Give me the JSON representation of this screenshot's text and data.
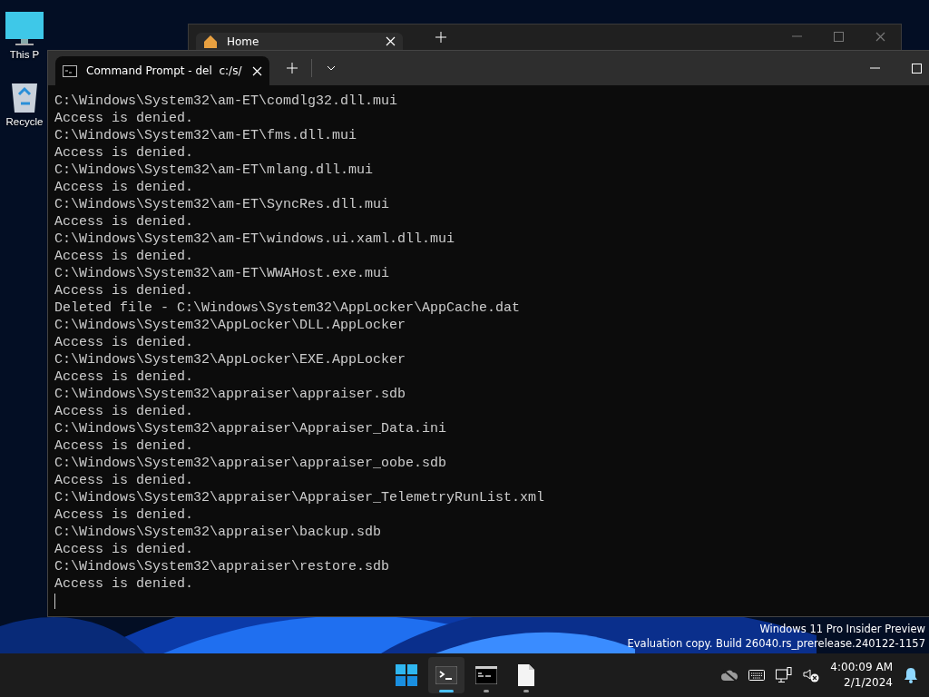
{
  "desktop_icons": [
    {
      "kind": "monitor",
      "label": "This P"
    },
    {
      "kind": "recycle",
      "label": "Recycle"
    }
  ],
  "back_window": {
    "tab_title": "Home"
  },
  "terminal": {
    "tab_title": "Command Prompt - del  c:/s/",
    "lines": [
      "C:\\Windows\\System32\\am-ET\\comdlg32.dll.mui",
      "Access is denied.",
      "C:\\Windows\\System32\\am-ET\\fms.dll.mui",
      "Access is denied.",
      "C:\\Windows\\System32\\am-ET\\mlang.dll.mui",
      "Access is denied.",
      "C:\\Windows\\System32\\am-ET\\SyncRes.dll.mui",
      "Access is denied.",
      "C:\\Windows\\System32\\am-ET\\windows.ui.xaml.dll.mui",
      "Access is denied.",
      "C:\\Windows\\System32\\am-ET\\WWAHost.exe.mui",
      "Access is denied.",
      "Deleted file - C:\\Windows\\System32\\AppLocker\\AppCache.dat",
      "C:\\Windows\\System32\\AppLocker\\DLL.AppLocker",
      "Access is denied.",
      "C:\\Windows\\System32\\AppLocker\\EXE.AppLocker",
      "Access is denied.",
      "C:\\Windows\\System32\\appraiser\\appraiser.sdb",
      "Access is denied.",
      "C:\\Windows\\System32\\appraiser\\Appraiser_Data.ini",
      "Access is denied.",
      "C:\\Windows\\System32\\appraiser\\appraiser_oobe.sdb",
      "Access is denied.",
      "C:\\Windows\\System32\\appraiser\\Appraiser_TelemetryRunList.xml",
      "Access is denied.",
      "C:\\Windows\\System32\\appraiser\\backup.sdb",
      "Access is denied.",
      "C:\\Windows\\System32\\appraiser\\restore.sdb",
      "Access is denied."
    ]
  },
  "watermark": [
    "Windows 11 Pro Insider Preview",
    "Evaluation copy. Build 26040.rs_prerelease.240122-1157"
  ],
  "taskbar": {
    "apps": [
      {
        "kind": "start",
        "selected": false,
        "running": false
      },
      {
        "kind": "terminal",
        "selected": true,
        "running": true
      },
      {
        "kind": "cmd",
        "selected": false,
        "running": true
      },
      {
        "kind": "file",
        "selected": false,
        "running": true
      }
    ],
    "tray": [
      {
        "kind": "cloud-off"
      },
      {
        "kind": "keyboard"
      },
      {
        "kind": "network"
      },
      {
        "kind": "speaker-muted"
      }
    ],
    "time": "4:00:09 AM",
    "date": "2/1/2024"
  }
}
